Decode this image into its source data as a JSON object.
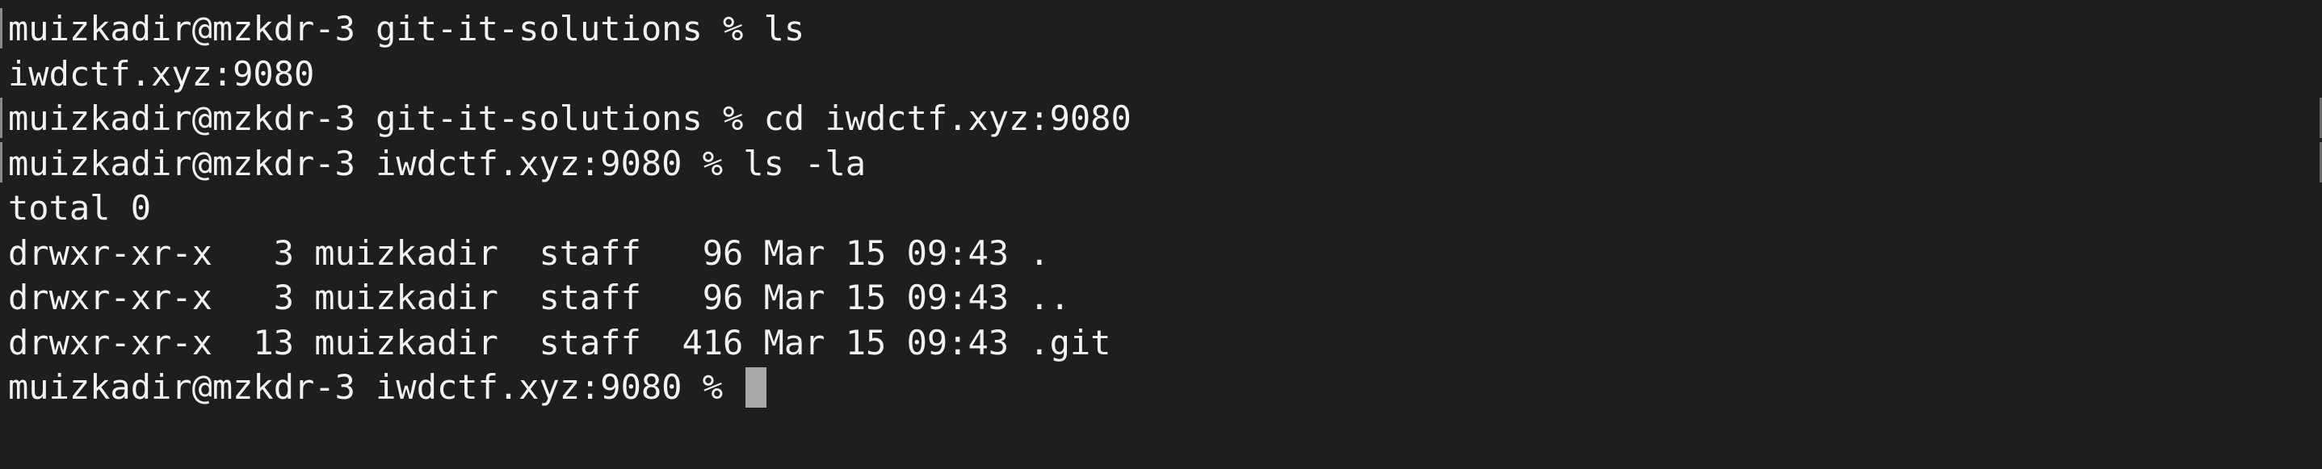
{
  "terminal": {
    "lines": [
      "muizkadir@mzkdr-3 git-it-solutions % ls",
      "iwdctf.xyz:9080",
      "muizkadir@mzkdr-3 git-it-solutions % cd iwdctf.xyz:9080",
      "muizkadir@mzkdr-3 iwdctf.xyz:9080 % ls -la",
      "total 0",
      "drwxr-xr-x   3 muizkadir  staff   96 Mar 15 09:43 .",
      "drwxr-xr-x   3 muizkadir  staff   96 Mar 15 09:43 ..",
      "drwxr-xr-x  13 muizkadir  staff  416 Mar 15 09:43 .git"
    ],
    "prompt": "muizkadir@mzkdr-3 iwdctf.xyz:9080 %"
  },
  "colors": {
    "background": "#1e1e1e",
    "text": "#f2f2f2",
    "cursor": "#a8a8a8"
  }
}
